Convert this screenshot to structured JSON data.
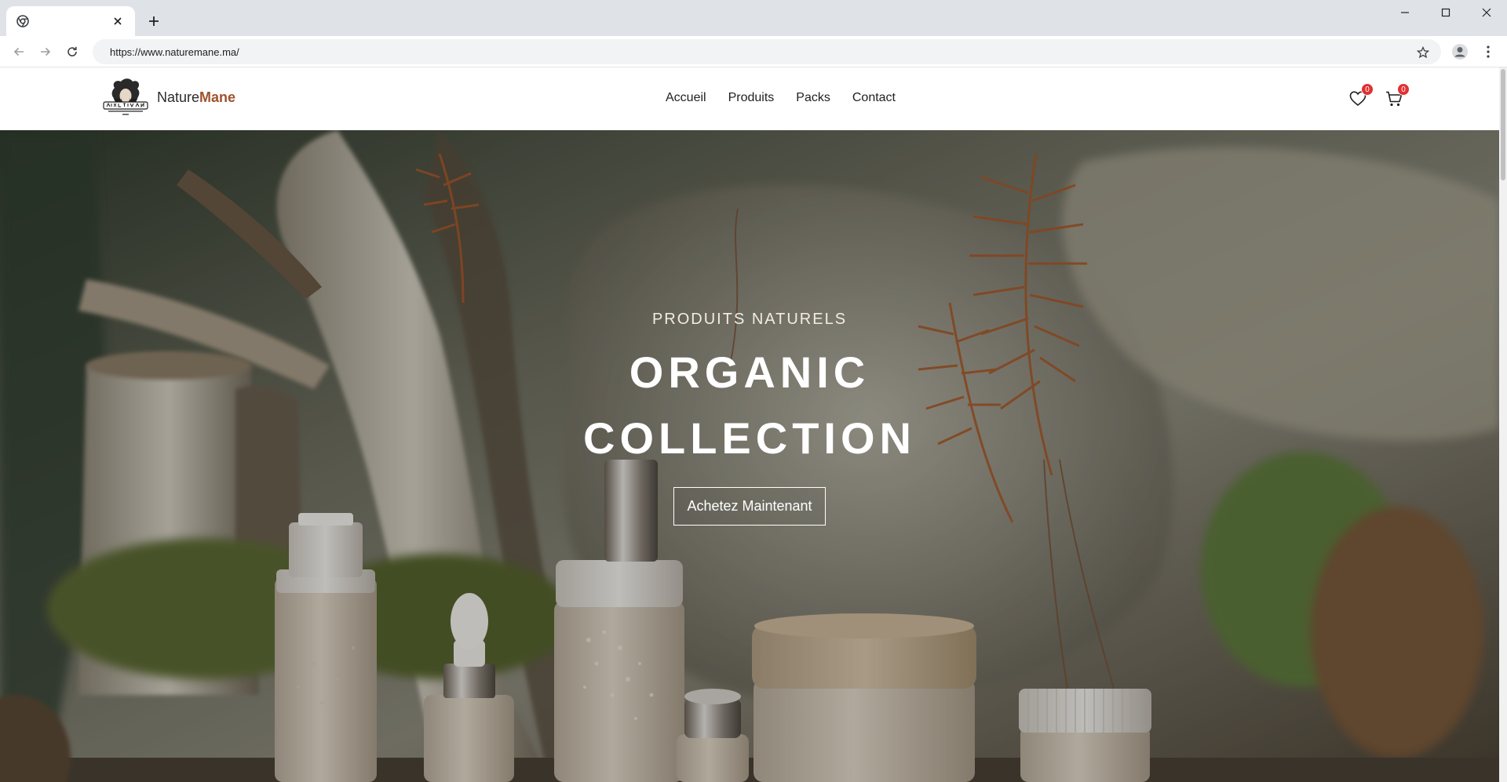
{
  "browser": {
    "tab_title": "",
    "url": "https://www.naturemane.ma/"
  },
  "site": {
    "brand_first": "Nature",
    "brand_second": "Mane",
    "nav": [
      {
        "label": "Accueil"
      },
      {
        "label": "Produits"
      },
      {
        "label": "Packs"
      },
      {
        "label": "Contact"
      }
    ],
    "wishlist_count": "0",
    "cart_count": "0"
  },
  "hero": {
    "eyebrow": "PRODUITS NATURELS",
    "title_line1": "ORGANIC",
    "title_line2": "COLLECTION",
    "cta_label": "Achetez Maintenant"
  },
  "colors": {
    "brand_accent": "#a0522d",
    "badge": "#e03131",
    "chrome_bg": "#dfe3e8"
  },
  "icons": [
    "chrome-icon",
    "close-icon",
    "plus-icon",
    "minimize-icon",
    "maximize-icon",
    "back-arrow-icon",
    "forward-arrow-icon",
    "reload-icon",
    "star-icon",
    "profile-icon",
    "more-vertical-icon",
    "heart-icon",
    "cart-icon"
  ]
}
